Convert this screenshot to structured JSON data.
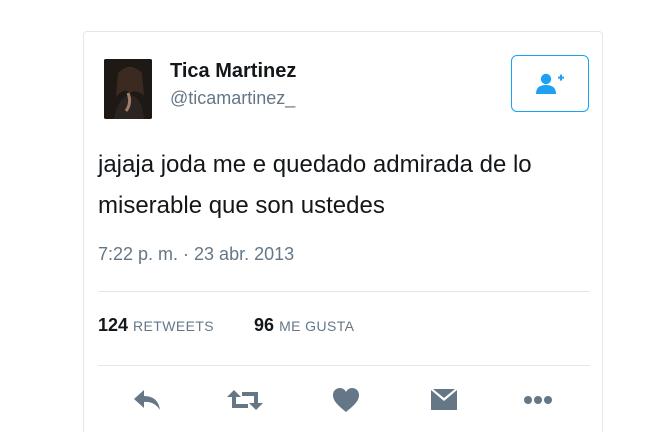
{
  "tweet": {
    "author": {
      "display_name": "Tica Martinez",
      "handle": "@ticamartinez_"
    },
    "follow_button_icon": "follow-icon",
    "text": "jajaja joda me e quedado admirada de lo miserable que son ustedes",
    "timestamp": "7:22 p. m. · 23 abr. 2013",
    "stats": {
      "retweets_count": "124",
      "retweets_label": "RETWEETS",
      "likes_count": "96",
      "likes_label": "ME GUSTA"
    },
    "actions": [
      "reply-icon",
      "retweet-icon",
      "like-icon",
      "message-icon",
      "more-icon"
    ]
  },
  "colors": {
    "accent": "#1da1f2",
    "icon_gray": "#657786",
    "muted_text": "#657786",
    "border": "#e1e8ed"
  }
}
